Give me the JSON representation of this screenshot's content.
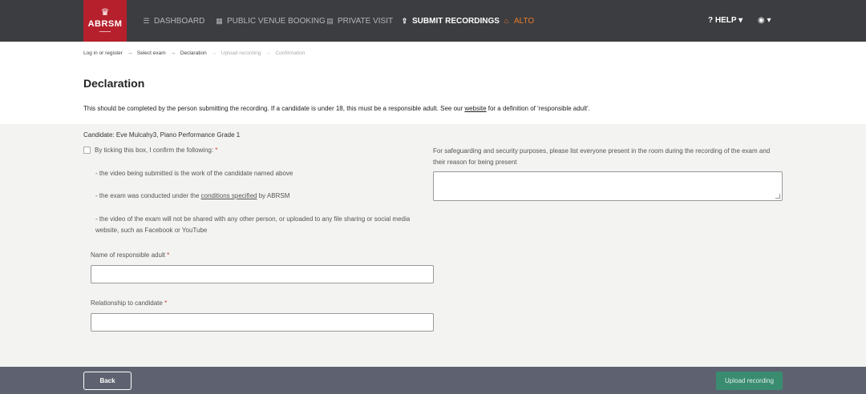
{
  "brand": {
    "name": "ABRSM",
    "crown_icon": "crown-icon"
  },
  "nav": {
    "dashboard": "DASHBOARD",
    "public_venue": "PUBLIC VENUE BOOKING",
    "private_visit": "PRIVATE VISIT",
    "submit_recordings": "SUBMIT RECORDINGS",
    "alto": "ALTO",
    "help": "HELP",
    "accent_color": "#e97a2c",
    "brand_color": "#b6202c"
  },
  "breadcrumb": {
    "step1": "Log in or register",
    "step2": "Select exam",
    "step3": "Declaration",
    "step4": "Upload recording",
    "step5": "Confirmation",
    "separator": "→"
  },
  "page": {
    "title": "Declaration",
    "intro_before": "This should be completed by the person submitting the recording. If a candidate is under 18, this must be a responsible adult. See our ",
    "intro_link": "website",
    "intro_after": " for a definition of 'responsible adult'."
  },
  "form": {
    "candidate": "Candidate: Eve Mulcahy3, Piano Performance Grade 1",
    "confirm_label": "By ticking this box, I confirm the following: ",
    "required_mark": "*",
    "bullet1": "- the video being submitted is the work of the candidate named above",
    "bullet2_before": "- the exam was conducted under the ",
    "bullet2_link": "conditions specified",
    "bullet2_after": " by ABRSM",
    "bullet3": "- the video of the exam will not be shared with any other person, or uploaded to any file sharing or social media website, such as Facebook or YouTube",
    "name_label": "Name of responsible adult ",
    "name_value": "",
    "relationship_label": "Relationship to candidate ",
    "relationship_value": "",
    "safeguarding_text": "For safeguarding and security purposes, please list everyone present in the room during the recording of the exam and their reason for being present",
    "safeguarding_value": ""
  },
  "footer": {
    "back": "Back",
    "upload": "Upload recording",
    "upload_color": "#3a8c70"
  }
}
